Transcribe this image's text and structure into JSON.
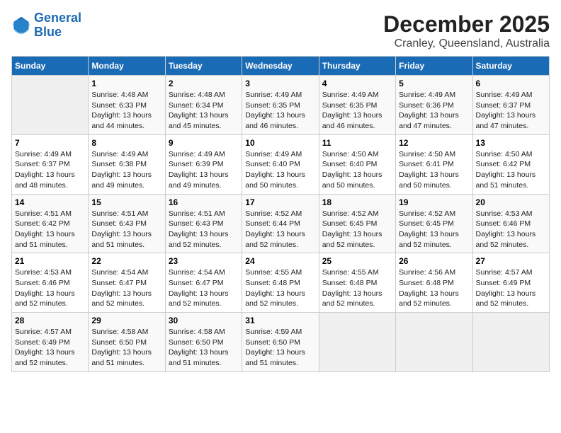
{
  "header": {
    "logo_line1": "General",
    "logo_line2": "Blue",
    "month": "December 2025",
    "location": "Cranley, Queensland, Australia"
  },
  "weekdays": [
    "Sunday",
    "Monday",
    "Tuesday",
    "Wednesday",
    "Thursday",
    "Friday",
    "Saturday"
  ],
  "weeks": [
    [
      {
        "day": "",
        "empty": true
      },
      {
        "day": "1",
        "sunrise": "4:48 AM",
        "sunset": "6:33 PM",
        "daylight": "13 hours and 44 minutes."
      },
      {
        "day": "2",
        "sunrise": "4:48 AM",
        "sunset": "6:34 PM",
        "daylight": "13 hours and 45 minutes."
      },
      {
        "day": "3",
        "sunrise": "4:49 AM",
        "sunset": "6:35 PM",
        "daylight": "13 hours and 46 minutes."
      },
      {
        "day": "4",
        "sunrise": "4:49 AM",
        "sunset": "6:35 PM",
        "daylight": "13 hours and 46 minutes."
      },
      {
        "day": "5",
        "sunrise": "4:49 AM",
        "sunset": "6:36 PM",
        "daylight": "13 hours and 47 minutes."
      },
      {
        "day": "6",
        "sunrise": "4:49 AM",
        "sunset": "6:37 PM",
        "daylight": "13 hours and 47 minutes."
      }
    ],
    [
      {
        "day": "7",
        "sunrise": "4:49 AM",
        "sunset": "6:37 PM",
        "daylight": "13 hours and 48 minutes."
      },
      {
        "day": "8",
        "sunrise": "4:49 AM",
        "sunset": "6:38 PM",
        "daylight": "13 hours and 49 minutes."
      },
      {
        "day": "9",
        "sunrise": "4:49 AM",
        "sunset": "6:39 PM",
        "daylight": "13 hours and 49 minutes."
      },
      {
        "day": "10",
        "sunrise": "4:49 AM",
        "sunset": "6:40 PM",
        "daylight": "13 hours and 50 minutes."
      },
      {
        "day": "11",
        "sunrise": "4:50 AM",
        "sunset": "6:40 PM",
        "daylight": "13 hours and 50 minutes."
      },
      {
        "day": "12",
        "sunrise": "4:50 AM",
        "sunset": "6:41 PM",
        "daylight": "13 hours and 50 minutes."
      },
      {
        "day": "13",
        "sunrise": "4:50 AM",
        "sunset": "6:42 PM",
        "daylight": "13 hours and 51 minutes."
      }
    ],
    [
      {
        "day": "14",
        "sunrise": "4:51 AM",
        "sunset": "6:42 PM",
        "daylight": "13 hours and 51 minutes."
      },
      {
        "day": "15",
        "sunrise": "4:51 AM",
        "sunset": "6:43 PM",
        "daylight": "13 hours and 51 minutes."
      },
      {
        "day": "16",
        "sunrise": "4:51 AM",
        "sunset": "6:43 PM",
        "daylight": "13 hours and 52 minutes."
      },
      {
        "day": "17",
        "sunrise": "4:52 AM",
        "sunset": "6:44 PM",
        "daylight": "13 hours and 52 minutes."
      },
      {
        "day": "18",
        "sunrise": "4:52 AM",
        "sunset": "6:45 PM",
        "daylight": "13 hours and 52 minutes."
      },
      {
        "day": "19",
        "sunrise": "4:52 AM",
        "sunset": "6:45 PM",
        "daylight": "13 hours and 52 minutes."
      },
      {
        "day": "20",
        "sunrise": "4:53 AM",
        "sunset": "6:46 PM",
        "daylight": "13 hours and 52 minutes."
      }
    ],
    [
      {
        "day": "21",
        "sunrise": "4:53 AM",
        "sunset": "6:46 PM",
        "daylight": "13 hours and 52 minutes."
      },
      {
        "day": "22",
        "sunrise": "4:54 AM",
        "sunset": "6:47 PM",
        "daylight": "13 hours and 52 minutes."
      },
      {
        "day": "23",
        "sunrise": "4:54 AM",
        "sunset": "6:47 PM",
        "daylight": "13 hours and 52 minutes."
      },
      {
        "day": "24",
        "sunrise": "4:55 AM",
        "sunset": "6:48 PM",
        "daylight": "13 hours and 52 minutes."
      },
      {
        "day": "25",
        "sunrise": "4:55 AM",
        "sunset": "6:48 PM",
        "daylight": "13 hours and 52 minutes."
      },
      {
        "day": "26",
        "sunrise": "4:56 AM",
        "sunset": "6:48 PM",
        "daylight": "13 hours and 52 minutes."
      },
      {
        "day": "27",
        "sunrise": "4:57 AM",
        "sunset": "6:49 PM",
        "daylight": "13 hours and 52 minutes."
      }
    ],
    [
      {
        "day": "28",
        "sunrise": "4:57 AM",
        "sunset": "6:49 PM",
        "daylight": "13 hours and 52 minutes."
      },
      {
        "day": "29",
        "sunrise": "4:58 AM",
        "sunset": "6:50 PM",
        "daylight": "13 hours and 51 minutes."
      },
      {
        "day": "30",
        "sunrise": "4:58 AM",
        "sunset": "6:50 PM",
        "daylight": "13 hours and 51 minutes."
      },
      {
        "day": "31",
        "sunrise": "4:59 AM",
        "sunset": "6:50 PM",
        "daylight": "13 hours and 51 minutes."
      },
      {
        "day": "",
        "empty": true
      },
      {
        "day": "",
        "empty": true
      },
      {
        "day": "",
        "empty": true
      }
    ]
  ]
}
